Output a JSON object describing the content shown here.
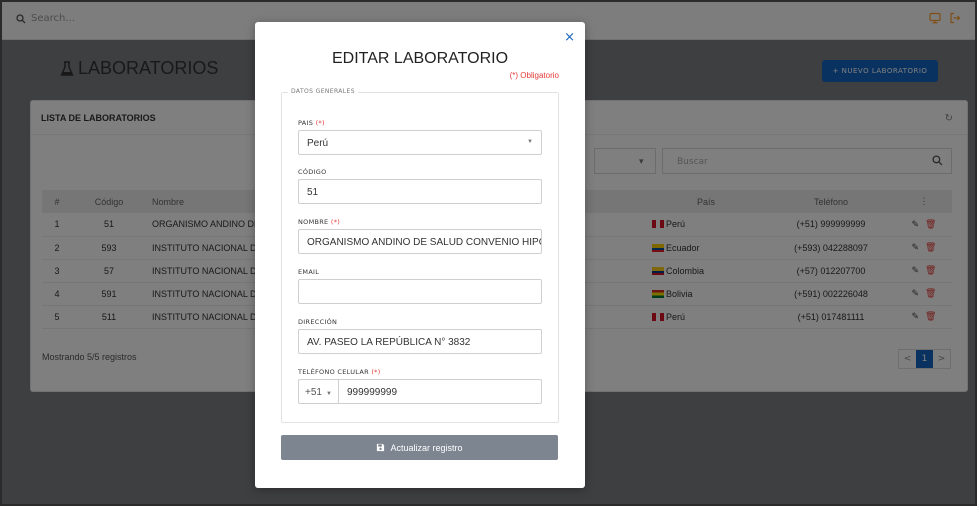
{
  "topbar": {
    "search_placeholder": "Search..."
  },
  "page": {
    "title": "LABORATORIOS",
    "new_button": "+ NUEVO LABORATORIO"
  },
  "list": {
    "title": "LISTA DE LABORATORIOS",
    "search_placeholder": "Buscar",
    "columns": [
      "#",
      "Código",
      "Nombre",
      "País",
      "Teléfono",
      "⋮"
    ],
    "rows": [
      {
        "num": "1",
        "code": "51",
        "name": "ORGANISMO ANDINO DE",
        "country": "Perú",
        "flag": "pe",
        "phone": "(+51) 999999999"
      },
      {
        "num": "2",
        "code": "593",
        "name": "INSTITUTO NACIONAL DI",
        "country": "Ecuador",
        "flag": "ec",
        "phone": "(+593) 042288097"
      },
      {
        "num": "3",
        "code": "57",
        "name": "INSTITUTO NACIONAL DI",
        "country": "Colombia",
        "flag": "co",
        "phone": "(+57) 012207700"
      },
      {
        "num": "4",
        "code": "591",
        "name": "INSTITUTO NACIONAL DI",
        "country": "Bolivia",
        "flag": "bo",
        "phone": "(+591) 002226048"
      },
      {
        "num": "5",
        "code": "511",
        "name": "INSTITUTO NACIONAL DI",
        "country": "Perú",
        "flag": "pe",
        "phone": "(+51) 017481111"
      }
    ],
    "showing": "Mostrando 5/5 registros",
    "pager": {
      "prev": "<",
      "current": "1",
      "next": ">"
    }
  },
  "modal": {
    "title": "EDITAR LABORATORIO",
    "required_note": "(*) Obligatorio",
    "close": "×",
    "section_legend": "DATOS GENERALES",
    "required_mark": "(*)",
    "fields": {
      "pais": {
        "label": "PAIS",
        "value": "Perú"
      },
      "codigo": {
        "label": "CÓDIGO",
        "value": "51"
      },
      "nombre": {
        "label": "NOMBRE",
        "value": "ORGANISMO ANDINO DE SALUD CONVENIO HIPÓLITO"
      },
      "email": {
        "label": "EMAIL",
        "value": ""
      },
      "direccion": {
        "label": "DIRECCIÓN",
        "value": "AV. PASEO LA REPÚBLICA N° 3832"
      },
      "telefono": {
        "label": "TELÉFONO CELULAR",
        "prefix": "+51",
        "value": "999999999"
      }
    },
    "submit_label": "Actualizar registro"
  },
  "colors": {
    "primary": "#1565c0",
    "danger": "#e53935",
    "submit_bg": "#7d8590"
  }
}
